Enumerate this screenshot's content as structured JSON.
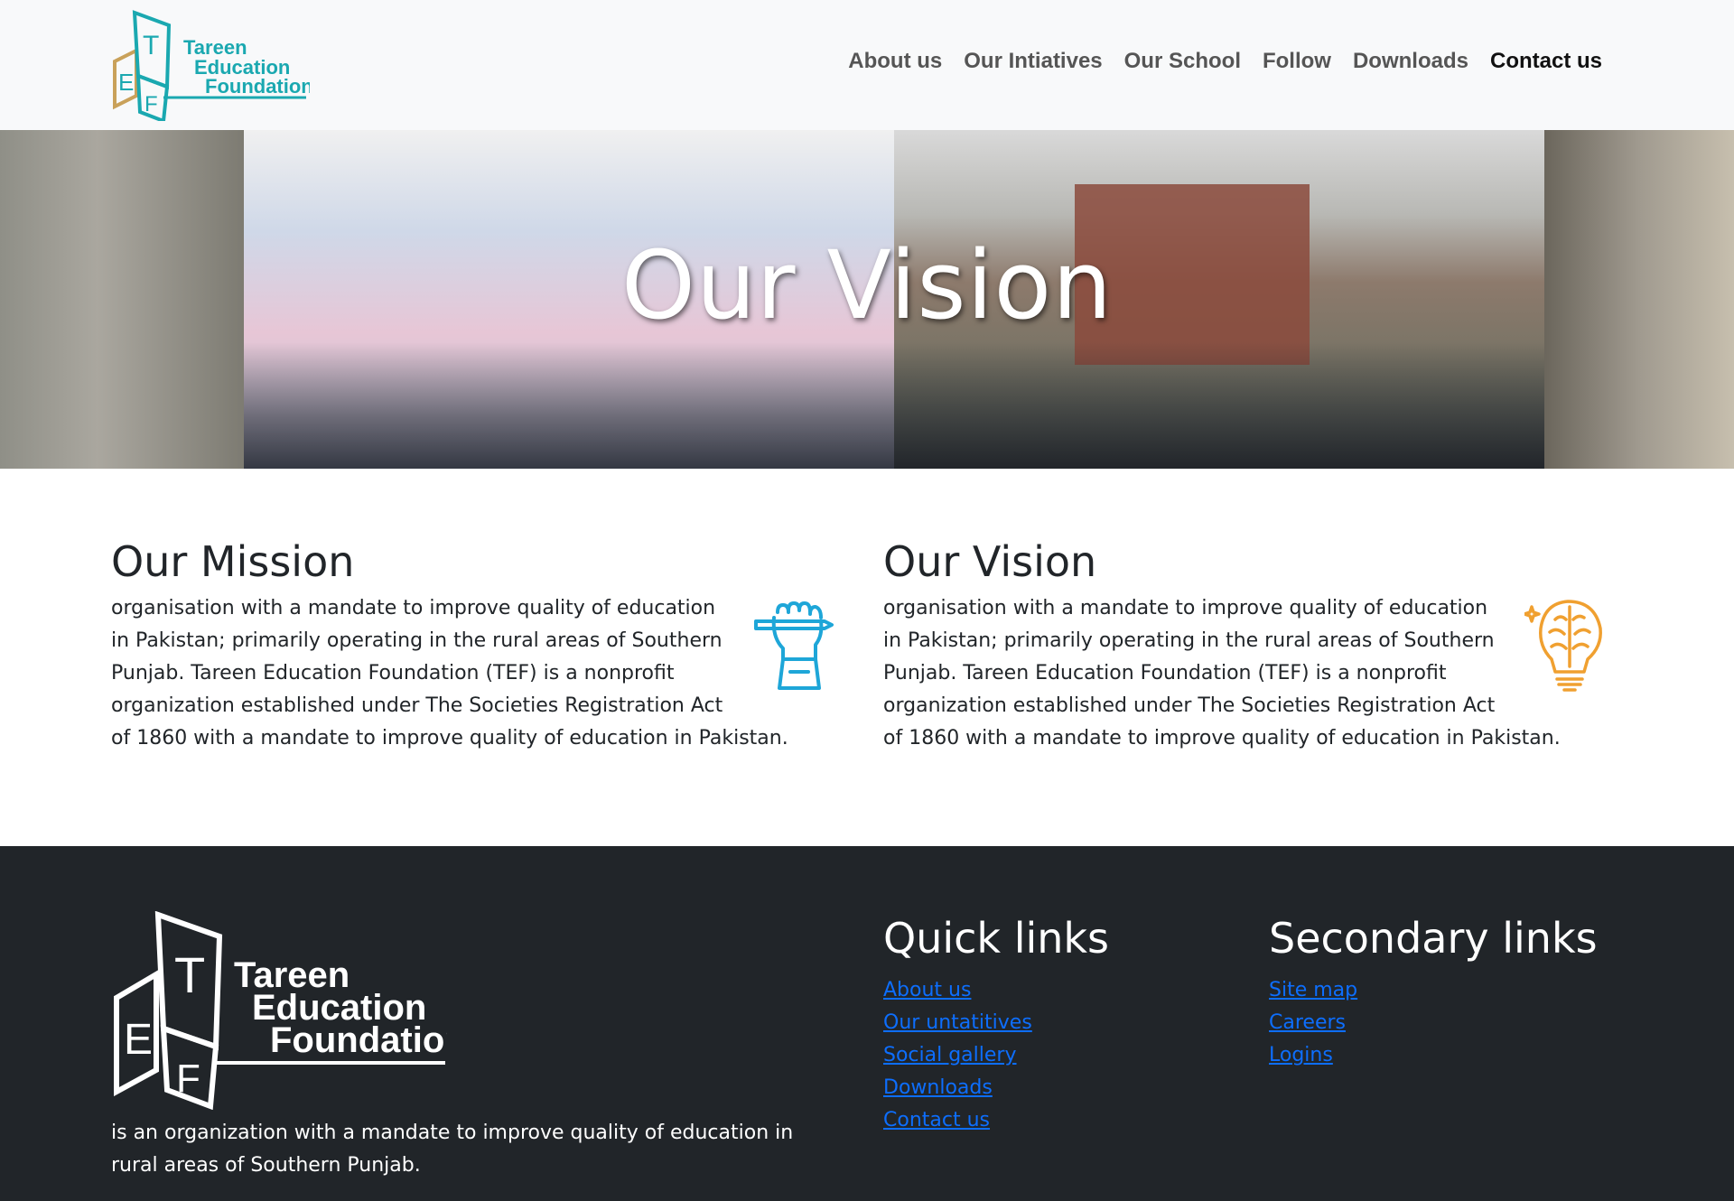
{
  "header": {
    "logo_text": [
      "Tareen",
      "Education",
      "Foundation"
    ],
    "logo_letters": [
      "E",
      "T",
      "F"
    ],
    "nav": [
      {
        "label": "About us"
      },
      {
        "label": "Our Intiatives"
      },
      {
        "label": "Our School"
      },
      {
        "label": "Follow"
      },
      {
        "label": "Downloads"
      },
      {
        "label": "Contact us"
      }
    ],
    "active_nav": "Contact us"
  },
  "hero": {
    "title": "Our Vision"
  },
  "mission": {
    "title": "Our Mission",
    "text": "organisation with a mandate to improve quality of education in Pakistan; primarily operating in the rural areas of Southern Punjab. Tareen Education Foundation (TEF) is a nonprofit organization established under The Societies Registration Act of 1860 with a mandate to improve quality of education in Pakistan.",
    "icon": "fist-pen-icon",
    "icon_color": "#1ea6d8"
  },
  "vision": {
    "title": "Our Vision",
    "text": "organisation with a mandate to improve quality of education in Pakistan; primarily operating in the rural areas of Southern Punjab. Tareen Education Foundation (TEF) is a nonprofit organization established under The Societies Registration Act of 1860 with a mandate to improve quality of education in Pakistan.",
    "icon": "brain-bulb-icon",
    "icon_color": "#f0a030"
  },
  "footer": {
    "description": "is an organization with a mandate to improve quality of education in rural areas of Southern Punjab.",
    "quick_links": {
      "title": "Quick links",
      "items": [
        "About us",
        "Our untatitives",
        "Social gallery",
        "Downloads",
        "Contact us"
      ]
    },
    "secondary_links": {
      "title": "Secondary links",
      "items": [
        "Site map",
        "Careers",
        "Logins"
      ]
    }
  },
  "colors": {
    "navbar_bg": "#f8f9fa",
    "footer_bg": "#212529",
    "link": "#0d6efd",
    "logo_teal": "#1aa8b0",
    "logo_gold": "#c9a15a"
  }
}
